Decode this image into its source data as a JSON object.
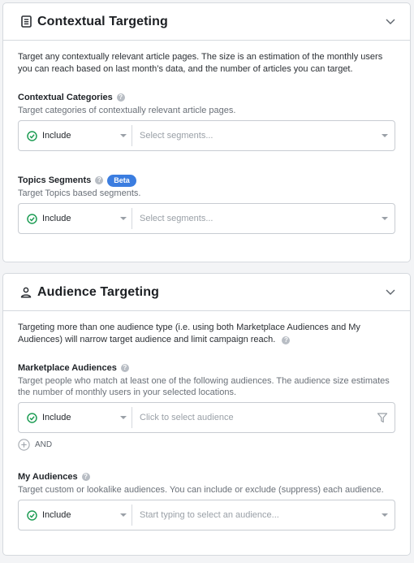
{
  "contextual": {
    "title": "Contextual Targeting",
    "icon": "document-icon",
    "intro": "Target any contextually relevant article pages. The size is an estimation of the monthly users you can reach based on last month’s data, and the number of articles you can target.",
    "fields": [
      {
        "label": "Contextual Categories",
        "description": "Target categories of contextually relevant article pages.",
        "mode": "Include",
        "placeholder": "Select segments..."
      },
      {
        "label": "Topics Segments",
        "badge": "Beta",
        "description": "Target Topics based segments.",
        "mode": "Include",
        "placeholder": "Select segments..."
      }
    ]
  },
  "audience": {
    "title": "Audience Targeting",
    "icon": "user-icon",
    "intro": "Targeting more than one audience type (i.e. using both Marketplace Audiences and My Audiences) will narrow target audience and limit campaign reach.",
    "fields": [
      {
        "label": "Marketplace Audiences",
        "description": "Target people who match at least one of the following audiences. The audience size estimates the number of monthly users in your selected locations.",
        "mode": "Include",
        "placeholder": "Click to select audience",
        "and_label": "AND"
      },
      {
        "label": "My Audiences",
        "description": "Target custom or lookalike audiences. You can include or exclude (suppress) each audience.",
        "mode": "Include",
        "placeholder": "Start typing to select an audience..."
      }
    ]
  },
  "help_glyph": "?",
  "colors": {
    "include_green": "#1f9d55",
    "beta_blue": "#3b7de0"
  }
}
